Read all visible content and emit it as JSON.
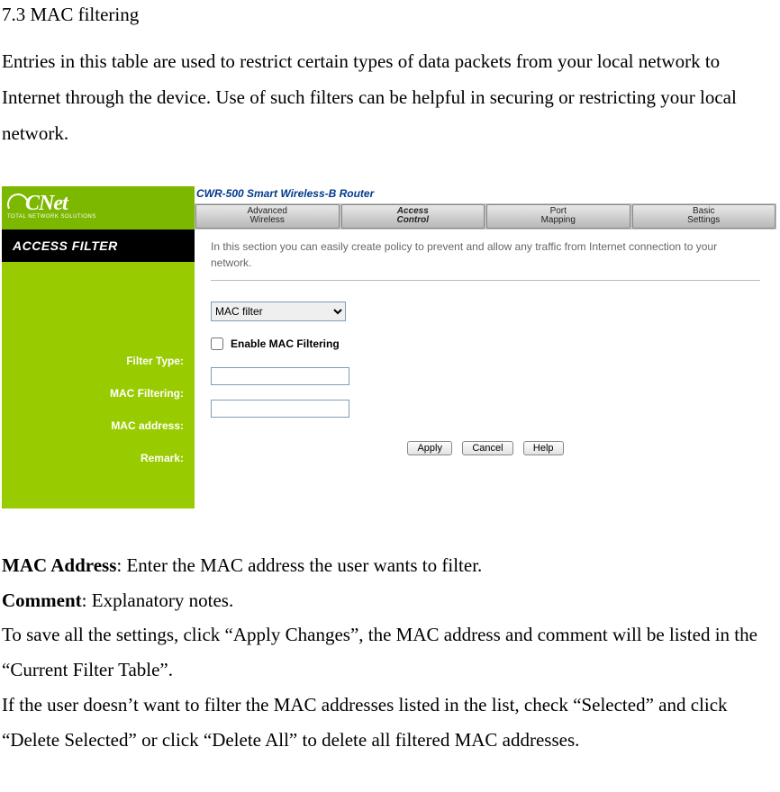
{
  "doc": {
    "section_heading": "7.3 MAC filtering",
    "intro": "Entries in this table are used to restrict certain types of data packets from your local network to Internet through the device. Use of such filters can be helpful in securing or restricting your local network."
  },
  "router": {
    "brand": "CNet",
    "brand_sub": "TOTAL NETWORK SOLUTIONS",
    "title": "CWR-500 Smart Wireless-B Router",
    "tabs": {
      "advanced_top": "Advanced",
      "advanced_bottom": "Wireless",
      "access_top": "Access",
      "access_bottom": "Control",
      "port_top": "Port",
      "port_bottom": "Mapping",
      "basic_top": "Basic",
      "basic_bottom": "Settings"
    },
    "sidebar_head": "ACCESS FILTER",
    "desc": "In this section you can easily create policy to prevent and allow any traffic from Internet connection to your network.",
    "labels": {
      "filter_type": "Filter Type:",
      "mac_filtering": "MAC Filtering:",
      "mac_address": "MAC address:",
      "remark": "Remark:"
    },
    "filter_type_value": "MAC filter",
    "enable_label": "Enable MAC Filtering",
    "mac_value": "",
    "remark_value": "",
    "buttons": {
      "apply": "Apply",
      "cancel": "Cancel",
      "help": "Help"
    }
  },
  "post": {
    "mac_label": "MAC Address",
    "mac_text": ": Enter the MAC address the user wants to filter.",
    "comment_label": "Comment",
    "comment_text": ": Explanatory notes.",
    "p3": "To save all the settings, click “Apply Changes”, the MAC address and comment will be listed in the “Current Filter Table”.",
    "p4": "If the user doesn’t want to filter the MAC addresses listed in the list, check “Selected” and click “Delete Selected” or click “Delete All” to delete all filtered MAC addresses."
  }
}
